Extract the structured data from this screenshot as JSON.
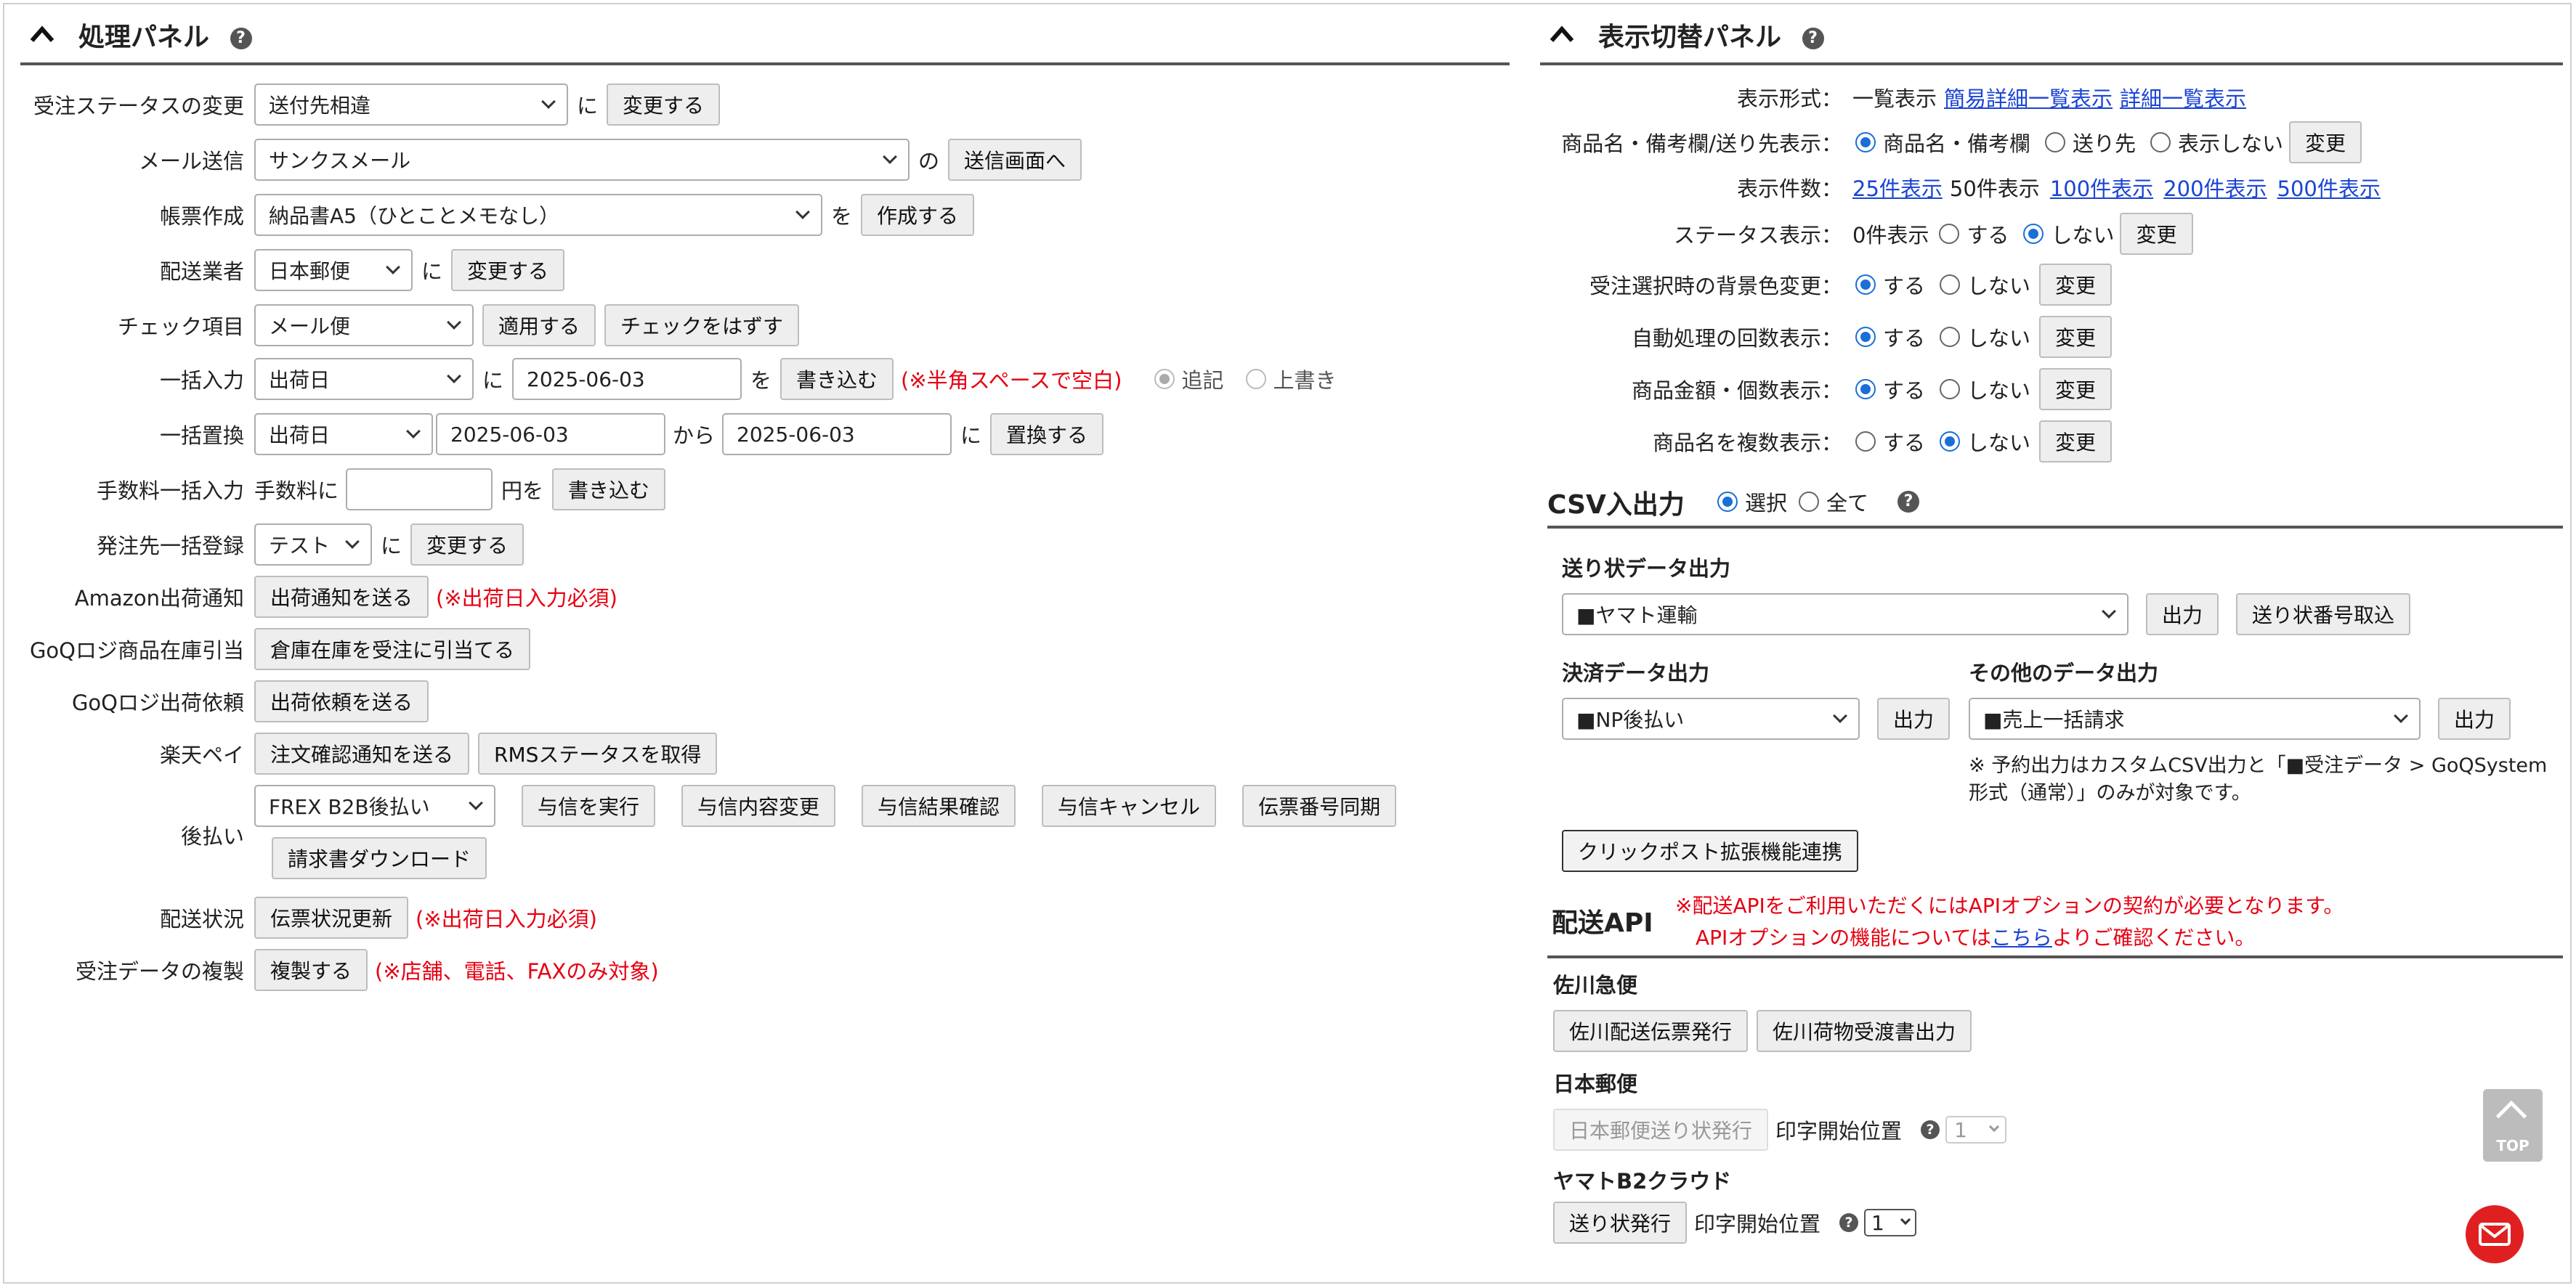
{
  "left_panel": {
    "title": "処理パネル",
    "rows": {
      "status_change": {
        "label": "受注ステータスの変更",
        "select": "送付先相違",
        "particle": "に",
        "button": "変更する"
      },
      "mail": {
        "label": "メール送信",
        "select": "サンクスメール",
        "particle": "の",
        "button": "送信画面へ"
      },
      "form": {
        "label": "帳票作成",
        "select": "納品書A5（ひとことメモなし）",
        "particle": "を",
        "button": "作成する"
      },
      "carrier": {
        "label": "配送業者",
        "select": "日本郵便",
        "particle": "に",
        "button": "変更する"
      },
      "check": {
        "label": "チェック項目",
        "select": "メール便",
        "button": "適用する",
        "button2": "チェックをはずす"
      },
      "bulk_input": {
        "label": "一括入力",
        "select": "出荷日",
        "particle": "に",
        "value": "2025-06-03",
        "particle2": "を",
        "button": "書き込む",
        "note": "(※半角スペースで空白)",
        "radio1": "追記",
        "radio2": "上書き"
      },
      "bulk_replace": {
        "label": "一括置換",
        "select": "出荷日",
        "from_value": "2025-06-03",
        "particle": "から",
        "to_value": "2025-06-03",
        "particle2": "に",
        "button": "置換する"
      },
      "fee": {
        "label": "手数料一括入力",
        "prefix": "手数料に",
        "value": "",
        "suffix": "円を",
        "button": "書き込む"
      },
      "dest": {
        "label": "発注先一括登録",
        "select": "テスト",
        "particle": "に",
        "button": "変更する"
      },
      "amazon": {
        "label": "Amazon出荷通知",
        "button": "出荷通知を送る",
        "note": "(※出荷日入力必須)"
      },
      "goq_stock": {
        "label": "GoQロジ商品在庫引当",
        "button": "倉庫在庫を受注に引当てる"
      },
      "goq_ship": {
        "label": "GoQロジ出荷依頼",
        "button": "出荷依頼を送る"
      },
      "rakuten": {
        "label": "楽天ペイ",
        "button": "注文確認通知を送る",
        "button2": "RMSステータスを取得"
      },
      "deferred": {
        "label": "後払い",
        "select": "FREX B2B後払い",
        "buttons": [
          "与信を実行",
          "与信内容変更",
          "与信結果確認",
          "与信キャンセル",
          "伝票番号同期"
        ],
        "invoice_button": "請求書ダウンロード"
      },
      "delivery": {
        "label": "配送状況",
        "button": "伝票状況更新",
        "note": "(※出荷日入力必須)"
      },
      "copy": {
        "label": "受注データの複製",
        "button": "複製する",
        "note": "(※店舗、電話、FAXのみ対象)"
      }
    }
  },
  "right_panel": {
    "title": "表示切替パネル",
    "display_format": {
      "label": "表示形式：",
      "current": "一覧表示",
      "link1": "簡易詳細一覧表示",
      "link2": "詳細一覧表示"
    },
    "product_note": {
      "label": "商品名・備考欄/送り先表示：",
      "opt1": "商品名・備考欄",
      "opt2": "送り先",
      "opt3": "表示しない",
      "button": "変更"
    },
    "count": {
      "label": "表示件数：",
      "link25": "25件表示",
      "current": "50件表示",
      "link100": "100件表示",
      "link200": "200件表示",
      "link500": "500件表示"
    },
    "status_display": {
      "label": "ステータス表示：",
      "prefix": "0件表示",
      "yes": "する",
      "no": "しない",
      "button": "変更"
    },
    "toggles": [
      {
        "label": "受注選択時の背景色変更：",
        "yes": "する",
        "no": "しない",
        "button": "変更",
        "selected": "yes"
      },
      {
        "label": "自動処理の回数表示：",
        "yes": "する",
        "no": "しない",
        "button": "変更",
        "selected": "yes"
      },
      {
        "label": "商品金額・個数表示：",
        "yes": "する",
        "no": "しない",
        "button": "変更",
        "selected": "yes"
      },
      {
        "label": "商品名を複数表示：",
        "yes": "する",
        "no": "しない",
        "button": "変更",
        "selected": "no"
      }
    ]
  },
  "csv": {
    "title": "CSV入出力",
    "opt_selected": "選択",
    "opt_all": "全て",
    "shipping_label_title": "送り状データ出力",
    "shipping_select": "■ヤマト運輸",
    "output_button": "出力",
    "import_button": "送り状番号取込",
    "payment_title": "決済データ出力",
    "payment_select": "■NP後払い",
    "other_title": "その他のデータ出力",
    "other_select": "■売上一括請求",
    "note_line1": "※ 予約出力はカスタムCSV出力と「■受注データ > GoQSystem",
    "note_line2": "形式（通常）」のみが対象です。",
    "clickpost_button": "クリックポスト拡張機能連携"
  },
  "api": {
    "title": "配送API",
    "note_line1": "※配送APIをご利用いただくにはAPIオプションの契約が必要となります。",
    "note_line2_pre": "APIオプションの機能については",
    "note_link": "こちら",
    "note_line2_post": "よりご確認ください。",
    "sagawa_title": "佐川急便",
    "sagawa_btn1": "佐川配送伝票発行",
    "sagawa_btn2": "佐川荷物受渡書出力",
    "japanpost_title": "日本郵便",
    "japanpost_btn": "日本郵便送り状発行",
    "print_pos_label": "印字開始位置",
    "japanpost_pos": "1",
    "yamato_title": "ヤマトB2クラウド",
    "yamato_btn": "送り状発行",
    "yamato_pos": "1"
  },
  "top_button": "TOP",
  "icons": {
    "collapse": "chevron-up-icon",
    "help": "help-circle-icon",
    "mail": "mail-icon"
  },
  "colors": {
    "link": "#1a44d6",
    "note_red": "#e60012",
    "radio_blue": "#1a6fd6",
    "mail_red": "#e02020"
  }
}
